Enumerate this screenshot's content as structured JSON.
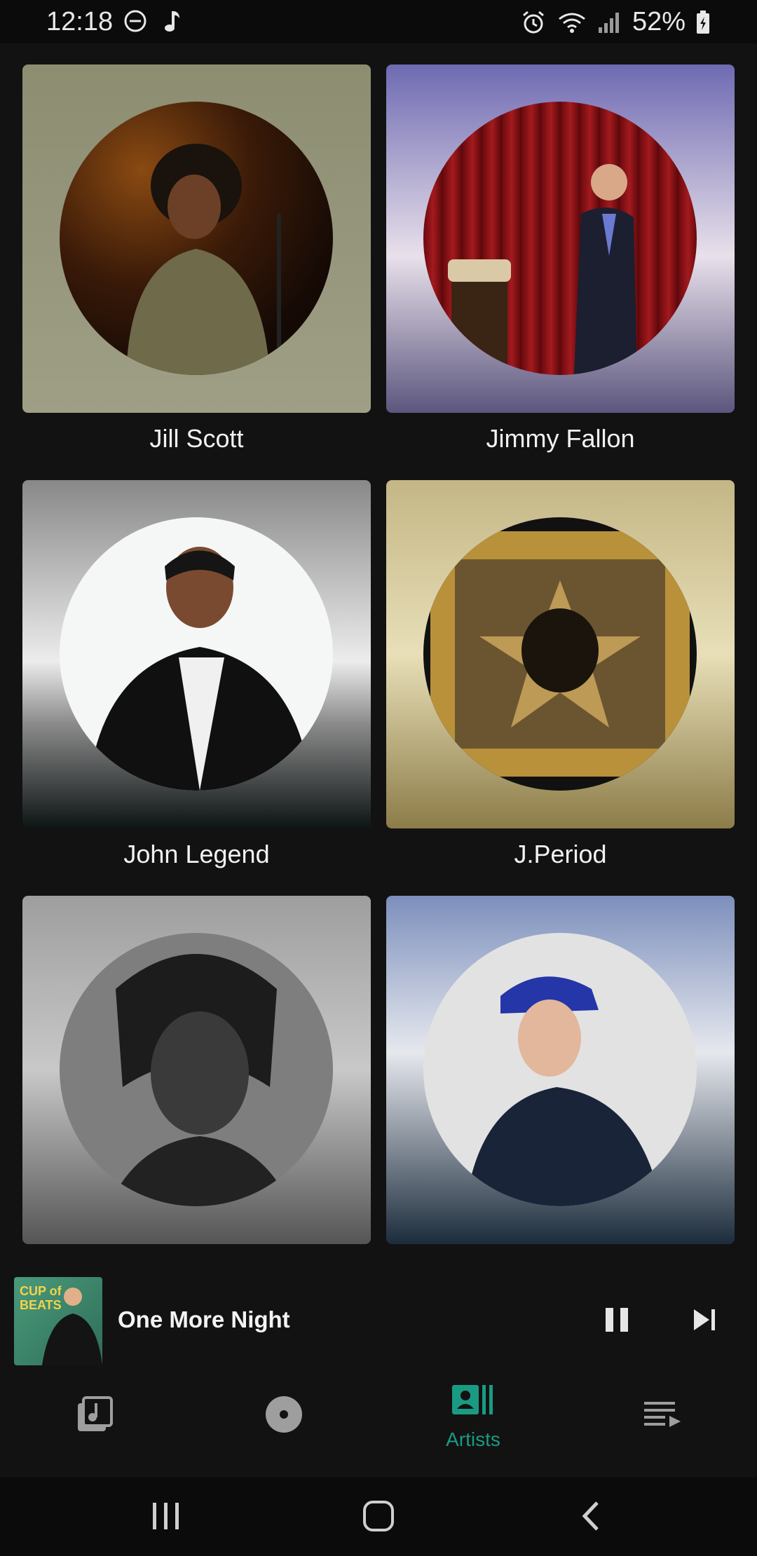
{
  "status_bar": {
    "time": "12:18",
    "battery": "52%",
    "icons": [
      "do-not-disturb-icon",
      "music-note-icon",
      "alarm-icon",
      "wifi-icon",
      "signal-icon",
      "battery-icon"
    ]
  },
  "artists": [
    {
      "name": "Jill Scott"
    },
    {
      "name": "Jimmy Fallon"
    },
    {
      "name": "John Legend"
    },
    {
      "name": "J.Period"
    },
    {
      "name": ""
    },
    {
      "name": ""
    }
  ],
  "now_playing": {
    "title": "One More Night",
    "art_text": "CUP of BEATS"
  },
  "bottom_nav": {
    "active": "Artists",
    "items": [
      {
        "icon": "library-music-icon",
        "label": ""
      },
      {
        "icon": "album-icon",
        "label": ""
      },
      {
        "icon": "artists-icon",
        "label": "Artists"
      },
      {
        "icon": "queue-icon",
        "label": ""
      }
    ]
  },
  "colors": {
    "accent": "#1b9a83",
    "background": "#121212"
  }
}
